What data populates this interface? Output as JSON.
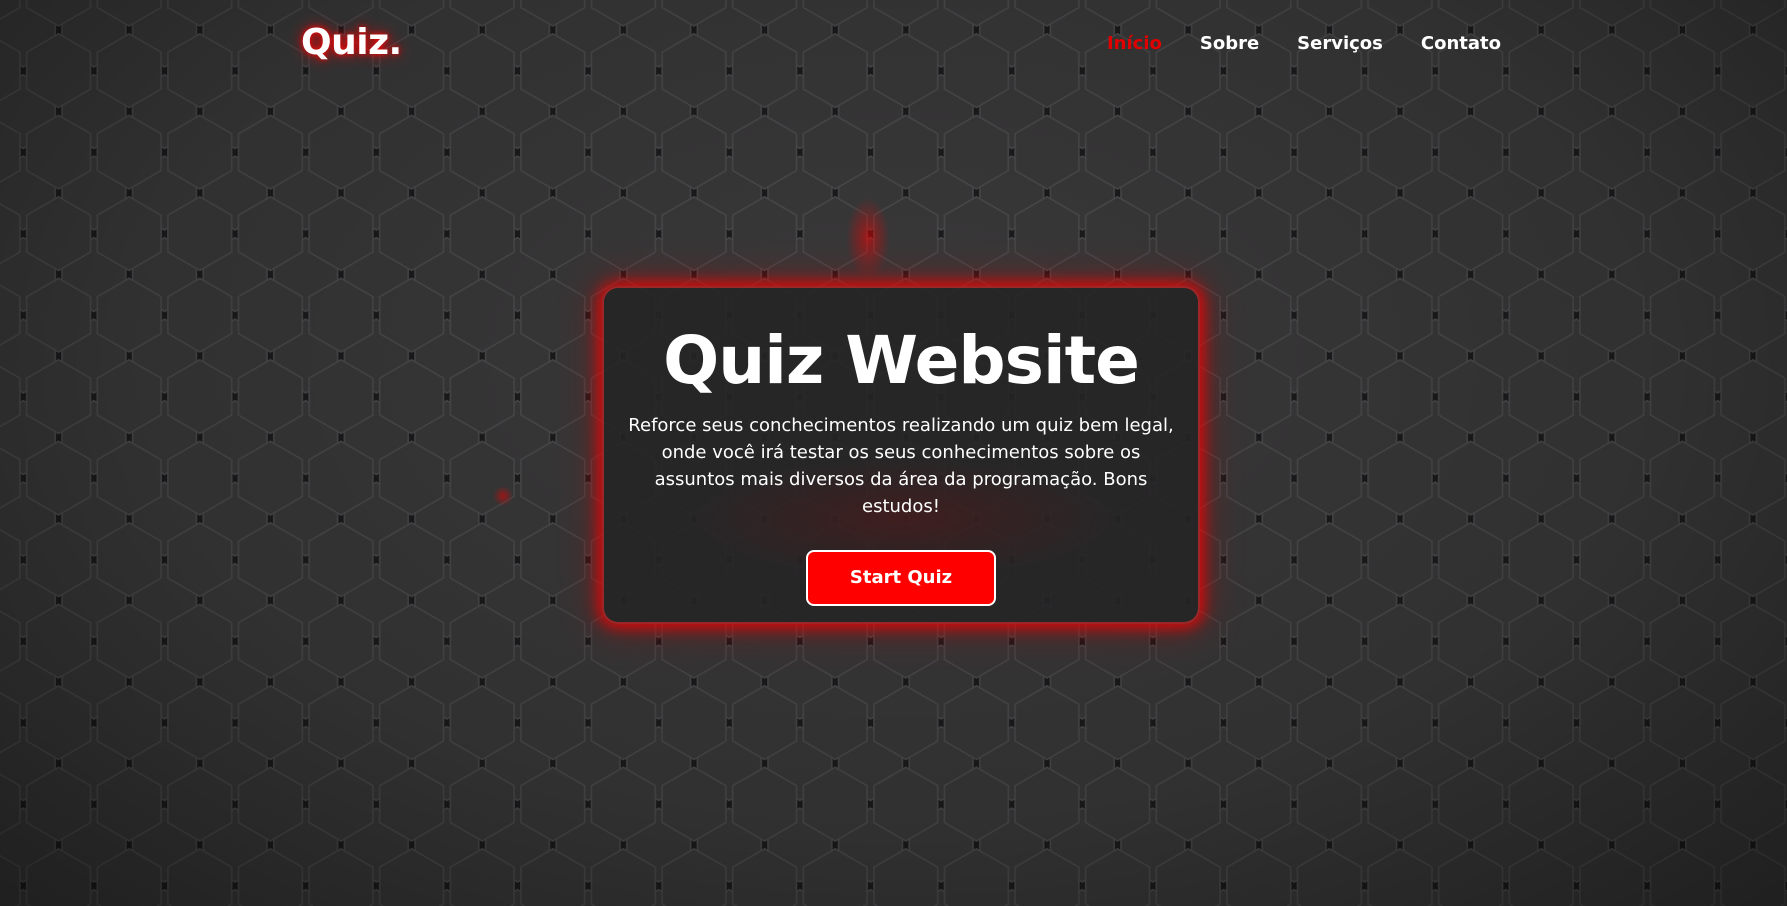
{
  "brand": {
    "logo": "Quiz.",
    "accent_color": "#ff0000",
    "background_color": "#2b2a2b"
  },
  "nav": {
    "items": [
      {
        "label": "Início",
        "active": true
      },
      {
        "label": "Sobre",
        "active": false
      },
      {
        "label": "Serviços",
        "active": false
      },
      {
        "label": "Contato",
        "active": false
      }
    ]
  },
  "hero": {
    "title": "Quiz Website",
    "description": "Reforce seus conchecimentos realizando um quiz bem legal, onde você irá testar os seus conhecimentos sobre os assuntos mais diversos da área da programação. Bons estudos!",
    "button_label": "Start Quiz"
  }
}
